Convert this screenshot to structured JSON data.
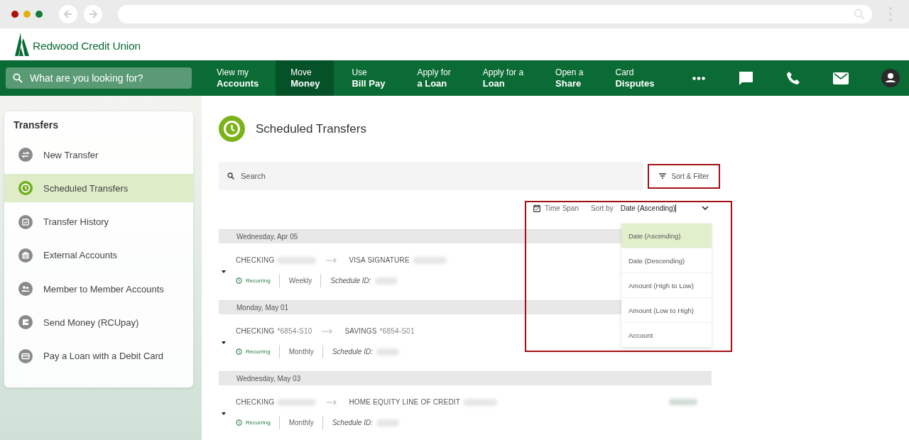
{
  "logo": {
    "text": "Redwood Credit Union"
  },
  "site_search": {
    "placeholder": "What are you looking for?"
  },
  "nav": [
    {
      "top": "View my",
      "bottom": "Accounts",
      "selected": false
    },
    {
      "top": "Move",
      "bottom": "Money",
      "selected": true
    },
    {
      "top": "Use",
      "bottom": "Bill Pay",
      "selected": false
    },
    {
      "top": "Apply for",
      "bottom": "a Loan",
      "selected": false
    },
    {
      "top": "Apply for a",
      "bottom": "Loan",
      "selected": false
    },
    {
      "top": "Open a",
      "bottom": "Share",
      "selected": false
    },
    {
      "top": "Card",
      "bottom": "Disputes",
      "selected": false
    }
  ],
  "sidebar": {
    "title": "Transfers",
    "items": [
      {
        "label": "New Transfer",
        "selected": false
      },
      {
        "label": "Scheduled Transfers",
        "selected": true
      },
      {
        "label": "Transfer History",
        "selected": false
      },
      {
        "label": "External Accounts",
        "selected": false
      },
      {
        "label": "Member to Member Accounts",
        "selected": false
      },
      {
        "label": "Send Money (RCUpay)",
        "selected": false
      },
      {
        "label": "Pay a Loan with a Debit Card",
        "selected": false
      }
    ]
  },
  "page": {
    "title": "Scheduled Transfers"
  },
  "search": {
    "placeholder": "Search"
  },
  "sort_filter": {
    "label": "Sort & Filter",
    "highlighted": true
  },
  "time_span": {
    "label": "Time Span"
  },
  "sort_by": {
    "label": "Sort by",
    "value": "Date (Ascending)",
    "highlighted": true,
    "expanded": true
  },
  "sort_options": [
    {
      "label": "Date (Ascending)",
      "selected": true
    },
    {
      "label": "Date (Descending)",
      "selected": false
    },
    {
      "label": "Amount (High to Low)",
      "selected": false
    },
    {
      "label": "Amount (Low to High)",
      "selected": false
    },
    {
      "label": "Account",
      "selected": false
    }
  ],
  "groups": [
    {
      "date": "Wednesday, Apr 05",
      "transfer": {
        "from": "CHECKING",
        "to": "VISA SIGNATURE",
        "status": "Recurring",
        "frequency": "Weekly",
        "id_label": "Schedule ID:"
      }
    },
    {
      "date": "Monday, May 01",
      "transfer": {
        "from": "CHECKING",
        "from_number": "*6854-S10",
        "to": "SAVINGS",
        "to_number": "*6854-S01",
        "status": "Recurring",
        "frequency": "Monthly",
        "id_label": "Schedule ID:"
      }
    },
    {
      "date": "Wednesday, May 03",
      "transfer": {
        "from": "CHECKING",
        "to": "HOME EQUITY LINE OF CREDIT",
        "status": "Recurring",
        "frequency": "Monthly",
        "id_label": "Schedule ID:",
        "amount_visible": true
      }
    }
  ]
}
